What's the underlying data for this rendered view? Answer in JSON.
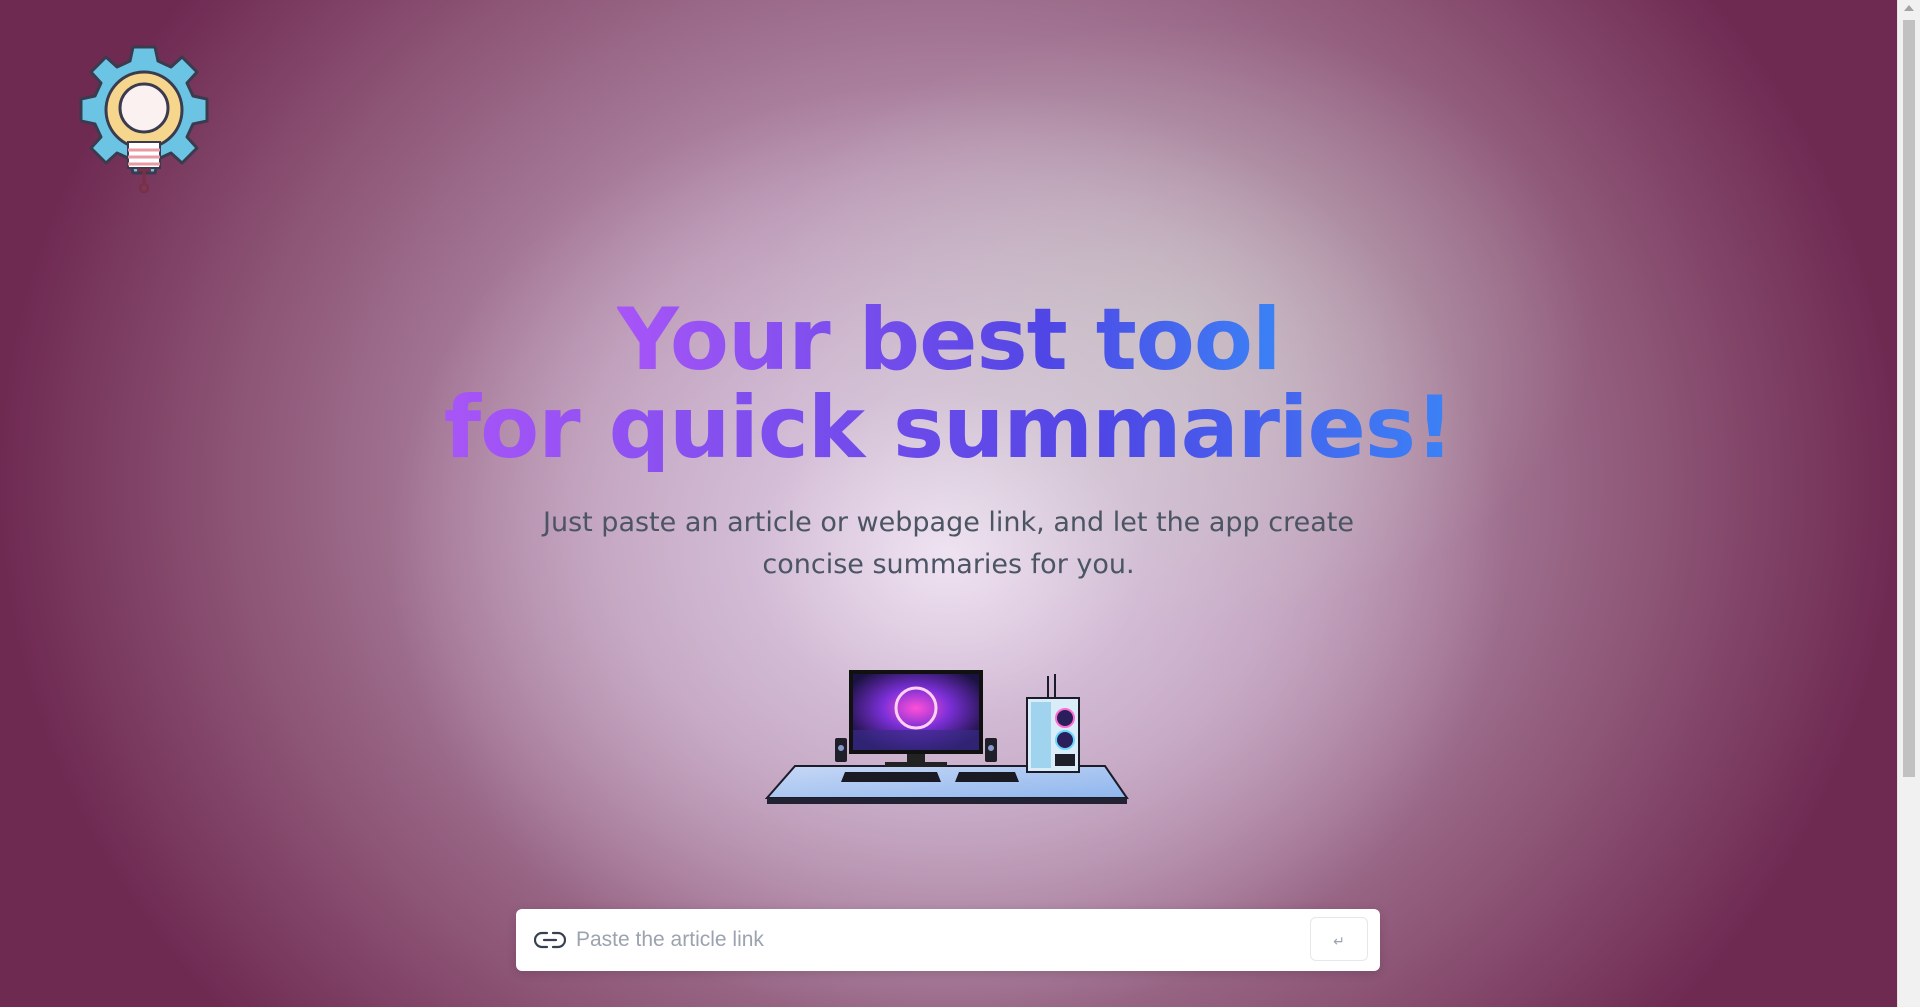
{
  "hero": {
    "title_line1": "Your best tool",
    "title_line2": "for quick summaries!",
    "subtitle": "Just paste an article or webpage link, and let the app create concise summaries for you."
  },
  "logo": {
    "icon": "lightbulb-gear-icon"
  },
  "illustration": {
    "icon": "desktop-setup-illustration"
  },
  "form": {
    "placeholder": "Paste the article link",
    "value": "",
    "link_icon": "link-icon",
    "submit_label": "↵"
  },
  "colors": {
    "gradient_start": "#a855f7",
    "gradient_mid": "#4f46e5",
    "gradient_end": "#3b82f6",
    "subtitle": "#4b5563",
    "background_edge": "#6f2a52",
    "background_center": "#f2e6f5"
  }
}
